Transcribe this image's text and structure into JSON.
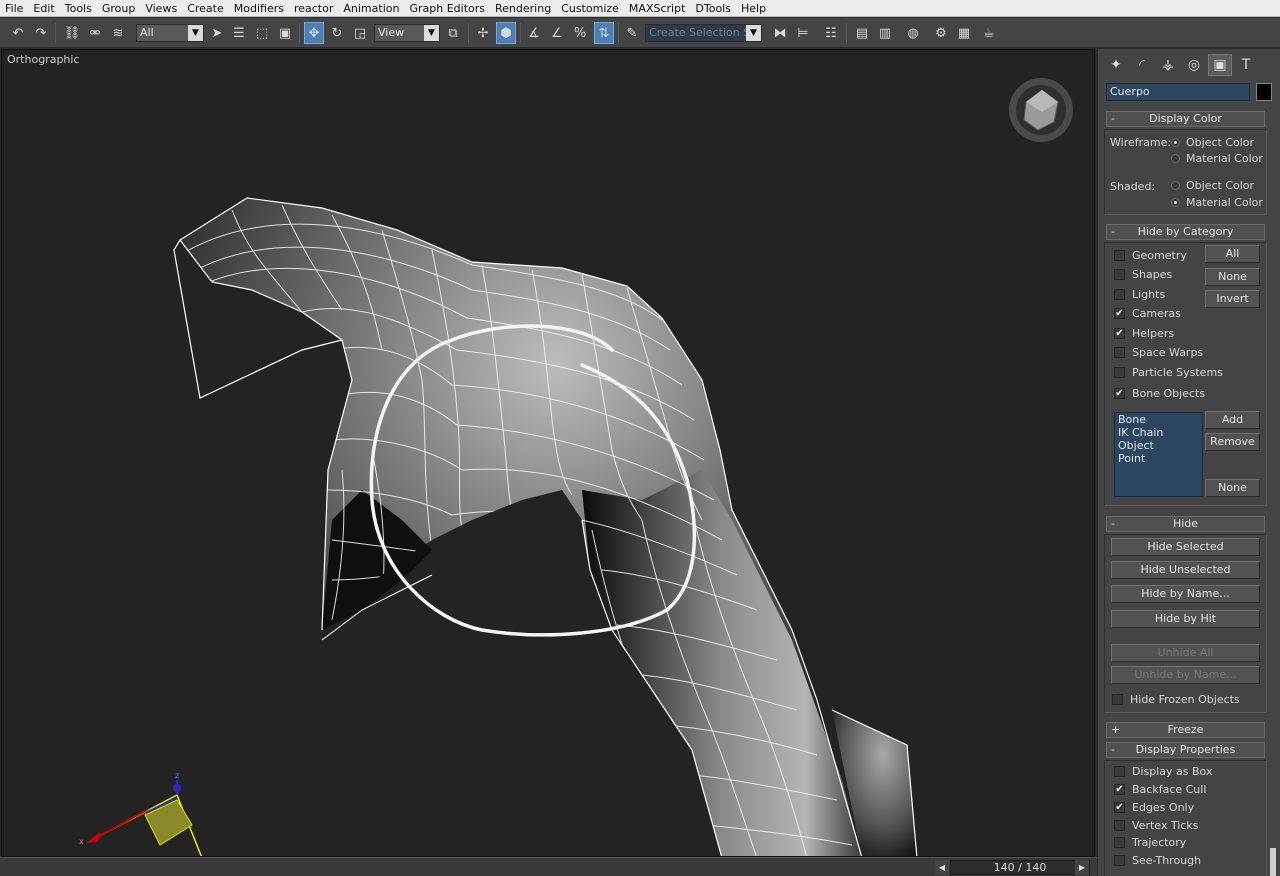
{
  "menu": [
    "File",
    "Edit",
    "Tools",
    "Group",
    "Views",
    "Create",
    "Modifiers",
    "reactor",
    "Animation",
    "Graph Editors",
    "Rendering",
    "Customize",
    "MAXScript",
    "DTools",
    "Help"
  ],
  "toolbar": {
    "filter_value": "All",
    "ref_coord_value": "View",
    "selection_set_placeholder": "Create Selection Se"
  },
  "viewport": {
    "label": "Orthographic"
  },
  "status": {
    "frame_counter": "140 / 140"
  },
  "panel": {
    "object_name": "Cuerpo",
    "object_color": "#000000",
    "display_color": {
      "title": "Display Color",
      "wireframe_label": "Wireframe:",
      "shaded_label": "Shaded:",
      "object_color": "Object Color",
      "material_color": "Material Color",
      "wireframe_selected": "Object Color",
      "shaded_selected": "Material Color"
    },
    "hide_by_category": {
      "title": "Hide by Category",
      "items": [
        {
          "label": "Geometry",
          "checked": false
        },
        {
          "label": "Shapes",
          "checked": false
        },
        {
          "label": "Lights",
          "checked": false
        },
        {
          "label": "Cameras",
          "checked": true
        },
        {
          "label": "Helpers",
          "checked": true
        },
        {
          "label": "Space Warps",
          "checked": false
        },
        {
          "label": "Particle Systems",
          "checked": false
        },
        {
          "label": "Bone Objects",
          "checked": true
        }
      ],
      "buttons": {
        "all": "All",
        "none": "None",
        "invert": "Invert"
      },
      "list": [
        "Bone",
        "IK Chain Object",
        "Point"
      ],
      "list_buttons": {
        "add": "Add",
        "remove": "Remove",
        "none": "None"
      }
    },
    "hide": {
      "title": "Hide",
      "buttons": [
        "Hide Selected",
        "Hide Unselected",
        "Hide by Name...",
        "Hide by Hit"
      ],
      "disabled_buttons": [
        "Unhide All",
        "Unhide by Name..."
      ],
      "frozen_label": "Hide Frozen Objects",
      "frozen_checked": false
    },
    "freeze": {
      "title": "Freeze",
      "collapsed_symbol": "+"
    },
    "display_properties": {
      "title": "Display Properties",
      "items": [
        {
          "label": "Display as Box",
          "checked": false
        },
        {
          "label": "Backface Cull",
          "checked": true
        },
        {
          "label": "Edges Only",
          "checked": true
        },
        {
          "label": "Vertex Ticks",
          "checked": false
        },
        {
          "label": "Trajectory",
          "checked": false
        },
        {
          "label": "See-Through",
          "checked": false
        }
      ]
    }
  },
  "gizmo_axes": {
    "x": "x",
    "z": "z"
  }
}
